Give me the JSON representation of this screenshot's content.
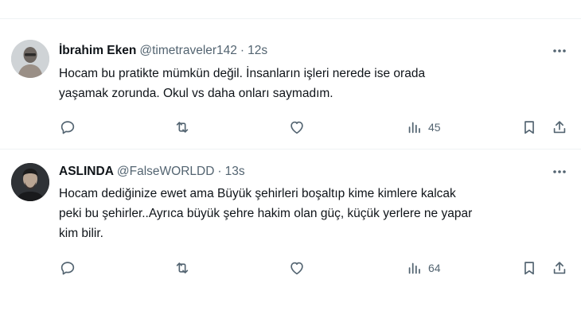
{
  "tweets": [
    {
      "name": "İbrahim Eken",
      "handle": "@timetraveler142",
      "separator": "·",
      "time": "12s",
      "lines": [
        "Hocam bu pratikte mümkün değil. İnsanların işleri nerede ise orada",
        "yaşamak zorunda. Okul vs daha onları saymadım."
      ],
      "views": "45"
    },
    {
      "name": "ASLINDA",
      "handle": "@FalseWORLDD",
      "separator": "·",
      "time": "13s",
      "lines": [
        "Hocam dediğinize ewet ama Büyük şehirleri boşaltıp kime kimlere kalcak",
        "peki bu şehirler..Ayrıca büyük şehre hakim olan güç, küçük yerlere ne yapar",
        "kim bilir."
      ],
      "views": "64"
    }
  ],
  "icons": {
    "more": "more-icon",
    "reply": "reply-icon",
    "retweet": "retweet-icon",
    "like": "like-icon",
    "views": "views-icon",
    "bookmark": "bookmark-icon",
    "share": "share-icon"
  },
  "colors": {
    "text": "#0f1419",
    "secondary": "#536471",
    "divider": "#eff3f4"
  }
}
